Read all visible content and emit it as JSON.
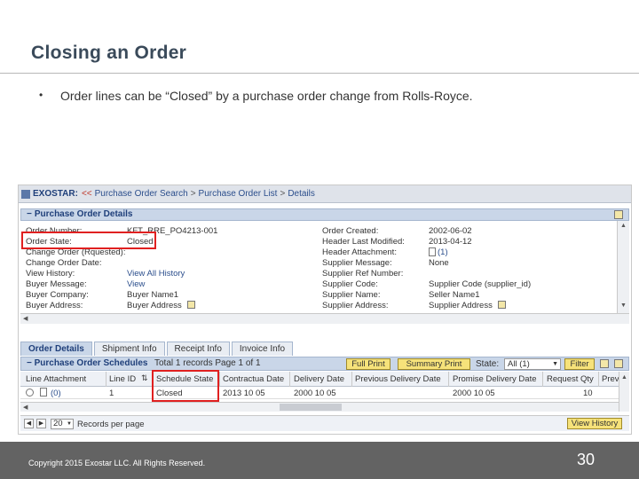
{
  "slide": {
    "title": "Closing an Order",
    "bullet_dot": "•",
    "bullet": "Order lines can be “Closed” by a purchase order change from Rolls-Royce.",
    "copyright": "Copyright 2015 Exostar LLC. All Rights Reserved.",
    "page_number": "30"
  },
  "screenshot": {
    "breadcrumb": {
      "brand": "EXOSTAR:",
      "separator": "<<",
      "items": [
        "Purchase Order Search",
        "Purchase Order List",
        "Details"
      ],
      "gt": ">"
    },
    "details_header": {
      "toggle": "−",
      "title": "Purchase Order Details"
    },
    "left_fields": [
      {
        "label": "Order Number:",
        "value": "KFT_RRE_PO4213-001"
      },
      {
        "label": "Order State:",
        "value": "Closed"
      },
      {
        "label": "Change Order (Rquested):",
        "value": ""
      },
      {
        "label": "Change Order Date:",
        "value": ""
      },
      {
        "label": "View History:",
        "value": "View All History"
      },
      {
        "label": "Buyer Message:",
        "value": "View"
      },
      {
        "label": "Buyer Company:",
        "value": "Buyer Name1"
      },
      {
        "label": "Buyer Address:",
        "value": "Buyer Address"
      }
    ],
    "right_fields": [
      {
        "label": "Order Created:",
        "value": "2002-06-02"
      },
      {
        "label": "Header Last Modified:",
        "value": "2013-04-12"
      },
      {
        "label": "Header Attachment:",
        "value": "(1)"
      },
      {
        "label": "Supplier Message:",
        "value": "None"
      },
      {
        "label": "Supplier Ref Number:",
        "value": ""
      },
      {
        "label": "Supplier Code:",
        "value": "Supplier Code (supplier_id)"
      },
      {
        "label": "Supplier Name:",
        "value": "Seller Name1"
      },
      {
        "label": "Supplier Address:",
        "value": "Supplier Address"
      }
    ],
    "tabs": [
      "Order Details",
      "Shipment Info",
      "Receipt Info",
      "Invoice Info"
    ],
    "schedules": {
      "toggle": "−",
      "title": "Purchase Order Schedules",
      "count": "Total 1 records Page 1 of 1",
      "full_print": "Full Print",
      "summary_print": "Summary Print",
      "state_label": "State:",
      "state_value": "All (1)",
      "filter": "Filter"
    },
    "grid": {
      "columns": [
        "Line Attachment",
        "Line ID",
        "Schedule State",
        "Contractua Date",
        "Delivery Date",
        "Previous Delivery Date",
        "Promise Delivery Date",
        "Request Qty",
        "Prev"
      ],
      "rows": [
        {
          "attachment": "(0)",
          "line_id": "1",
          "schedule_state": "Closed",
          "contract_date": "2013 10 05",
          "delivery_date": "2000 10 05",
          "previous_delivery_date": "",
          "promise_delivery_date": "2000 10 05",
          "request_qty": "10"
        }
      ]
    },
    "pager": {
      "page_size": "20",
      "records_label": "Records per page",
      "view_history": "View History"
    }
  }
}
